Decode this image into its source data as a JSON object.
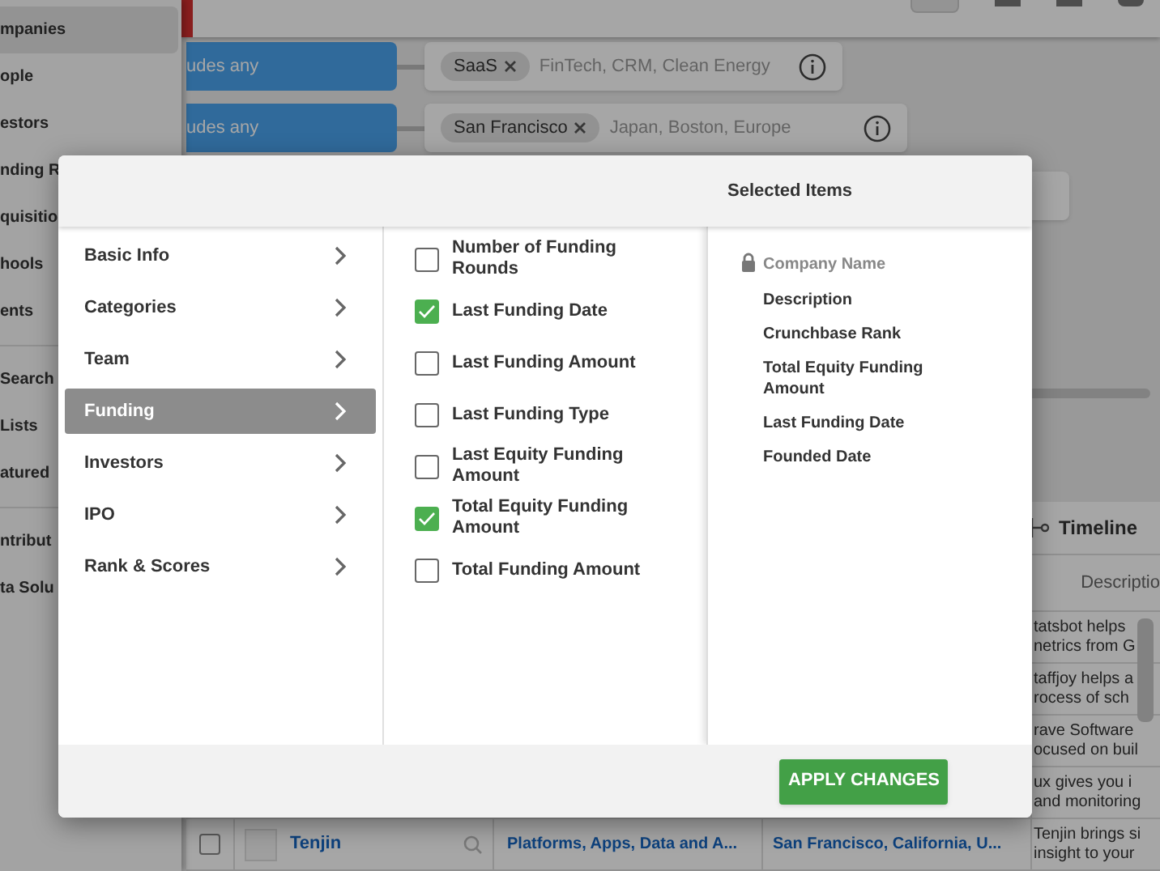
{
  "sidebar": {
    "sections": [
      [
        {
          "label": "mpanies",
          "selected": true
        },
        {
          "label": "ople",
          "selected": false
        },
        {
          "label": "estors",
          "selected": false
        },
        {
          "label": "nding R",
          "selected": false
        },
        {
          "label": "quisitio",
          "selected": false
        },
        {
          "label": "hools",
          "selected": false
        },
        {
          "label": "ents",
          "selected": false
        }
      ],
      [
        {
          "label": "Search",
          "selected": false
        },
        {
          "label": "Lists",
          "selected": false
        },
        {
          "label": "atured",
          "selected": false
        }
      ],
      [
        {
          "label": "ntribut",
          "selected": false
        },
        {
          "label": "ta Solu",
          "selected": false
        }
      ]
    ]
  },
  "filters": [
    {
      "operator": "udes any",
      "chips": [
        "SaaS"
      ],
      "placeholder": "FinTech, CRM, Clean Energy"
    },
    {
      "operator": "udes any",
      "chips": [
        "San Francisco"
      ],
      "placeholder": "Japan, Boston, Europe"
    }
  ],
  "table": {
    "title": "Timeline",
    "column_header": "Descriptio",
    "rows": [
      {
        "description": [
          "tatsbot helps",
          "netrics from G"
        ]
      },
      {
        "description": [
          "taffjoy helps a",
          "rocess of sch"
        ]
      },
      {
        "description": [
          "rave Software",
          "ocused on buil"
        ]
      },
      {
        "description": [
          "ux gives you i",
          "and monitoring"
        ]
      },
      {
        "checked": false,
        "name": "Tenjin",
        "category": "Platforms, Apps, Data and A...",
        "location": "San Francisco, California, U...",
        "description": [
          "Tenjin brings si",
          "insight to your"
        ]
      }
    ]
  },
  "dialog": {
    "header": "Selected Items",
    "categories": [
      {
        "label": "Basic Info",
        "selected": false
      },
      {
        "label": "Categories",
        "selected": false
      },
      {
        "label": "Team",
        "selected": false
      },
      {
        "label": "Funding",
        "selected": true
      },
      {
        "label": "Investors",
        "selected": false
      },
      {
        "label": "IPO",
        "selected": false
      },
      {
        "label": "Rank & Scores",
        "selected": false
      }
    ],
    "fields": [
      {
        "label": "Number of Funding Rounds",
        "checked": false
      },
      {
        "label": "Last Funding Date",
        "checked": true
      },
      {
        "label": "Last Funding Amount",
        "checked": false
      },
      {
        "label": "Last Funding Type",
        "checked": false
      },
      {
        "label": "Last Equity Funding Amount",
        "checked": false
      },
      {
        "label": "Total Equity Funding Amount",
        "checked": true
      },
      {
        "label": "Total Funding Amount",
        "checked": false
      }
    ],
    "selected_items": [
      {
        "label": "Company Name",
        "locked": true
      },
      {
        "label": "Description",
        "locked": false
      },
      {
        "label": "Crunchbase Rank",
        "locked": false
      },
      {
        "label": "Total Equity Funding Amount",
        "locked": false
      },
      {
        "label": "Last Funding Date",
        "locked": false
      },
      {
        "label": "Founded Date",
        "locked": false
      }
    ],
    "apply_button": "APPLY CHANGES"
  }
}
